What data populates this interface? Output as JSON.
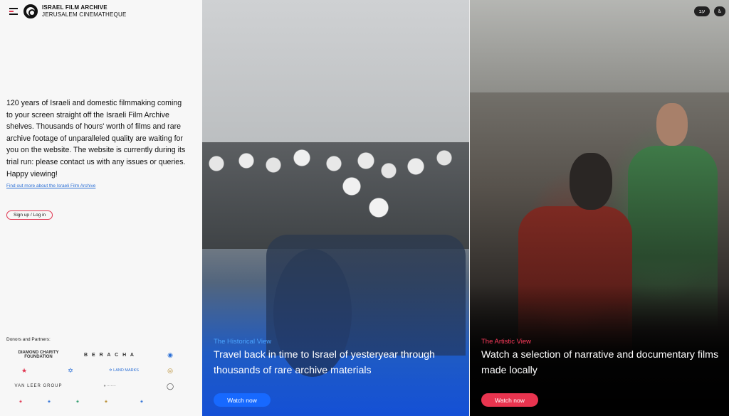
{
  "header": {
    "logo_line1": "ISRAEL FILM ARCHIVE",
    "logo_line2": "JERUSALEM CINEMATHEQUE",
    "lang_label": "עב",
    "accessibility_label": "♿"
  },
  "intro": {
    "text": "120 years of Israeli and domestic filmmaking coming to your screen straight off the Israeli Film Archive shelves. Thousands of hours' worth of films and rare archive footage of unparalleled quality are waiting for you on the website. The website is currently during its trial run: please contact us with any issues or queries. Happy viewing!",
    "link": "Find out more about the Israeli Film Archive",
    "signup": "Sign up / Log in"
  },
  "partners": {
    "title": "Donors and Partners:",
    "row1": [
      "DIAMOND CHARITY FOUNDATION",
      "B E R A C H A",
      "◉"
    ],
    "row2": [
      "★",
      "✡",
      "✡ LAND MARKS",
      "◎"
    ],
    "row3": [
      "VAN LEER GROUP",
      "◑ ·······",
      "◯"
    ],
    "row4": [
      "◈",
      "◈",
      "◈",
      "◈",
      "◈"
    ]
  },
  "cards": {
    "historical": {
      "kicker": "The Historical View",
      "headline": "Travel back in time to Israel of yesteryear through thousands of rare archive materials",
      "button": "Watch now"
    },
    "artistic": {
      "kicker": "The Artistic View",
      "headline": "Watch a selection of narrative and documentary films made locally",
      "button": "Watch now"
    }
  },
  "colors": {
    "accent_red": "#e8344f",
    "accent_blue": "#1769ff"
  }
}
